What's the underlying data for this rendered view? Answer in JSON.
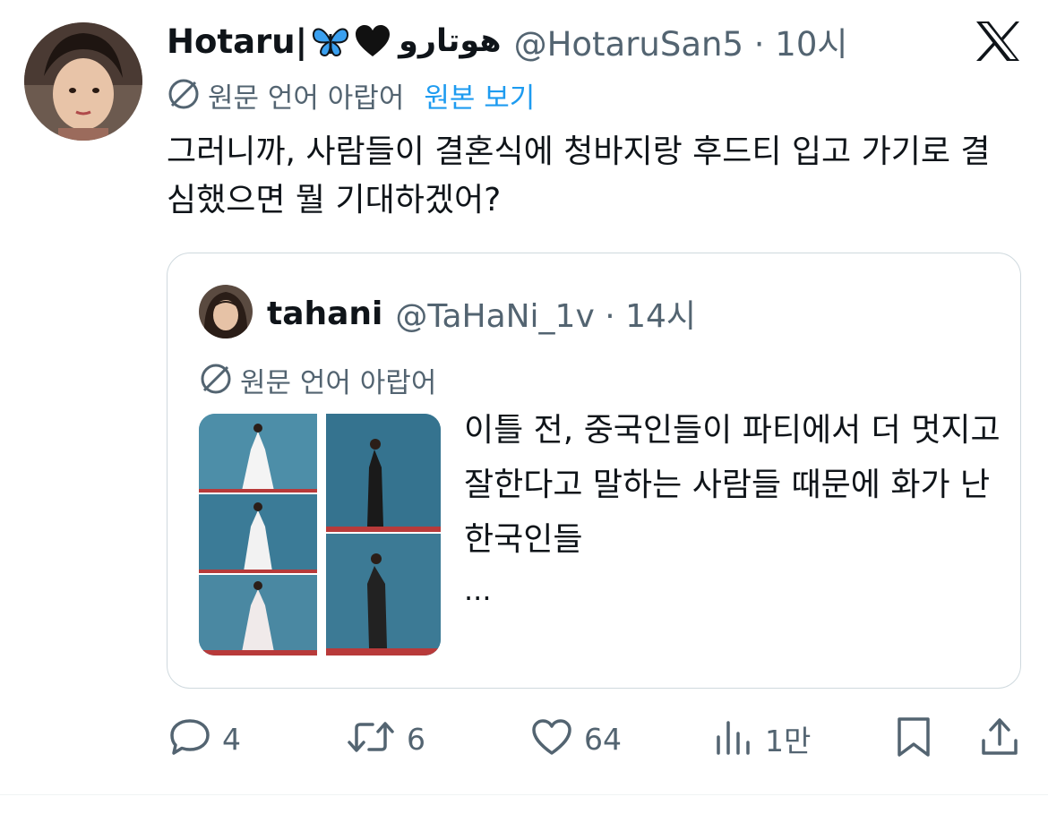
{
  "tweet": {
    "display_name": "Hotaru|",
    "display_name_arabic": "هوتارو",
    "handle_time": "@HotaruSan5 · 10시",
    "translation_note": "원문 언어 아랍어",
    "show_original": "원본 보기",
    "text": "그러니까, 사람들이 결혼식에 청바지랑 후드티 입고 가기로 결심했으면 뭘 기대하겠어?"
  },
  "quoted": {
    "display_name": "tahani",
    "handle_time": "@TaHaNi_1v · 14시",
    "translation_note": "원문 언어 아랍어",
    "text": "이틀 전, 중국인들이 파티에서 더 멋지고 잘한다고 말하는 사람들 때문에 화가 난 한국인들",
    "ellipsis": "..."
  },
  "actions": {
    "reply_count": "4",
    "retweet_count": "6",
    "like_count": "64",
    "views_count": "1만"
  },
  "icons": {
    "brand": "x-logo-icon",
    "butterfly": "blue-butterfly-icon",
    "heart": "black-heart-icon",
    "translate": "translate-icon",
    "reply": "reply-icon",
    "retweet": "retweet-icon",
    "like": "like-icon",
    "views": "views-icon",
    "bookmark": "bookmark-icon",
    "share": "share-icon"
  },
  "colors": {
    "text": "#0f1419",
    "secondary": "#536471",
    "link": "#1d9bf0",
    "border": "#cfd9de"
  }
}
